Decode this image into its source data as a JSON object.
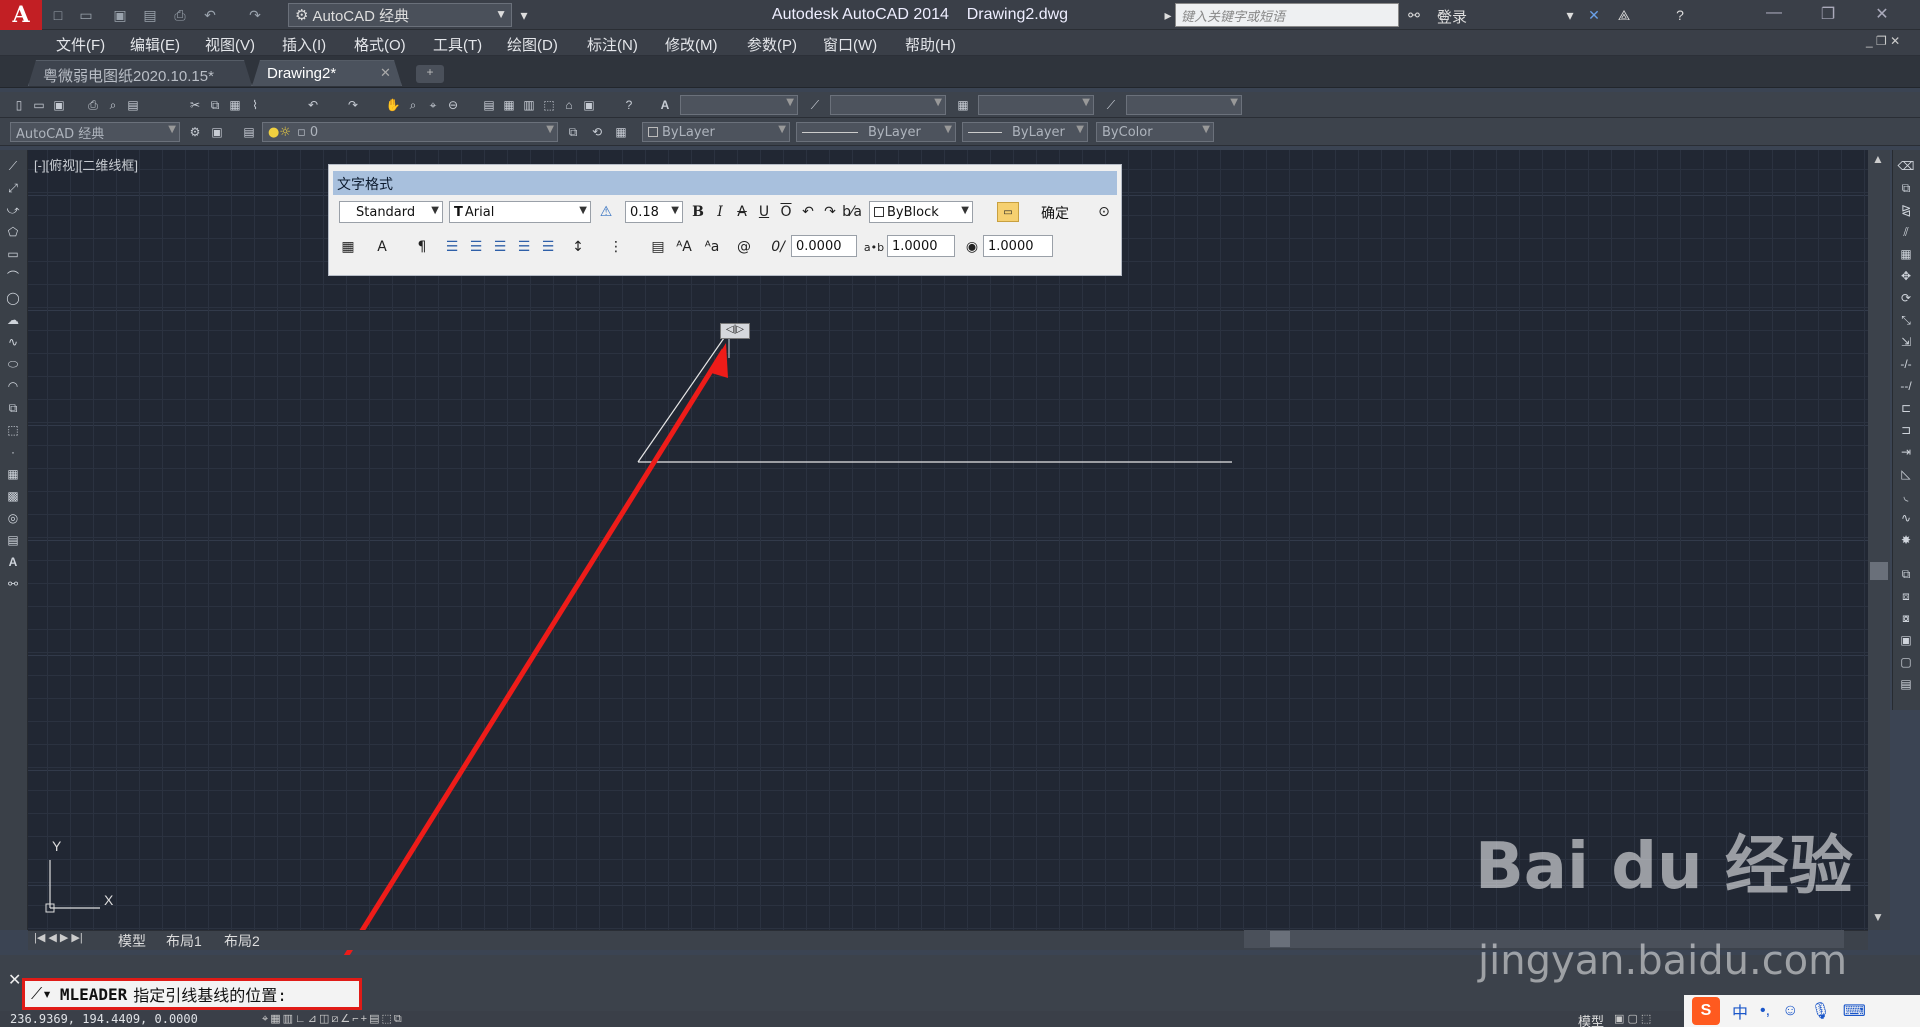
{
  "app": {
    "logo": "A",
    "window_title": "Autodesk AutoCAD 2014    Drawing2.dwg",
    "workspace": "AutoCAD 经典",
    "search_placeholder": "键入关键字或短语",
    "login": "登录"
  },
  "menu": [
    "文件(F)",
    "编辑(E)",
    "视图(V)",
    "插入(I)",
    "格式(O)",
    "工具(T)",
    "绘图(D)",
    "标注(N)",
    "修改(M)",
    "参数(P)",
    "窗口(W)",
    "帮助(H)"
  ],
  "tabs": [
    {
      "label": "粤微弱电图纸2020.10.15*"
    },
    {
      "label": "Drawing2*",
      "active": true
    }
  ],
  "toolbar": {
    "workspace2": "AutoCAD 经典",
    "layer": "0",
    "color": "ByLayer",
    "linetype": "ByLayer",
    "lineweight": "ByLayer",
    "plotstyle": "ByColor"
  },
  "viewport": {
    "label": "[-][俯视][二维线框]"
  },
  "text_format": {
    "title": "文字格式",
    "style": "Standard",
    "font": "Arial",
    "height": "0.18",
    "color": "ByBlock",
    "ok": "确定",
    "oblique": "0.0000",
    "tracking": "1.0000",
    "width_factor": "1.0000"
  },
  "layout_tabs": [
    "模型",
    "布局1",
    "布局2"
  ],
  "ucs": {
    "y": "Y",
    "x": "X"
  },
  "command": {
    "name": "MLEADER",
    "prompt": "指定引线基线的位置:"
  },
  "status": {
    "coords": "236.9369, 194.4409, 0.0000",
    "model": "模型"
  },
  "ime": {
    "lang": "中"
  },
  "watermark": {
    "brand": "Bai du 经验",
    "url": "jingyan.baidu.com"
  },
  "colors": {
    "accent_red": "#e01b17",
    "canvas": "#212733"
  }
}
